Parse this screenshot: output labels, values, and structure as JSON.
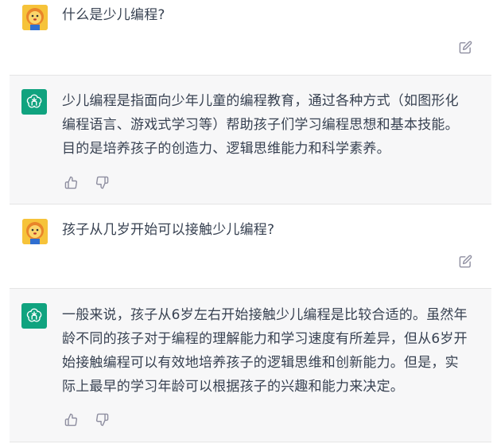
{
  "conversation": [
    {
      "role": "user",
      "text": "什么是少儿编程?",
      "edit_icon": "edit-icon"
    },
    {
      "role": "assistant",
      "lines": [
        "少儿编程是指面向少年儿童的编程教育，通过各种方式（如图形化",
        "编程语言、游戏式学习等）帮助孩子们学习编程思想和基本技能。",
        "目的是培养孩子的创造力、逻辑思维能力和科学素养。"
      ],
      "actions": [
        "thumbs-up-icon",
        "thumbs-down-icon"
      ]
    },
    {
      "role": "user",
      "text": "孩子从几岁开始可以接触少儿编程?",
      "edit_icon": "edit-icon"
    },
    {
      "role": "assistant",
      "lines": [
        "一般来说，孩子从6岁左右开始接触少儿编程是比较合适的。虽然年",
        "龄不同的孩子对于编程的理解能力和学习速度有所差异，但从6岁开",
        "始接触编程可以有效地培养孩子的逻辑思维和创新能力。但是，实",
        "际上最早的学习年龄可以根据孩子的兴趣和能力来决定。"
      ],
      "actions": [
        "thumbs-up-icon",
        "thumbs-down-icon"
      ]
    }
  ],
  "colors": {
    "assistant_bg": "#f7f7f8",
    "gpt_avatar": "#10a37f",
    "user_avatar": "#f4c531",
    "text": "#374151",
    "icon": "#8e8ea0"
  }
}
